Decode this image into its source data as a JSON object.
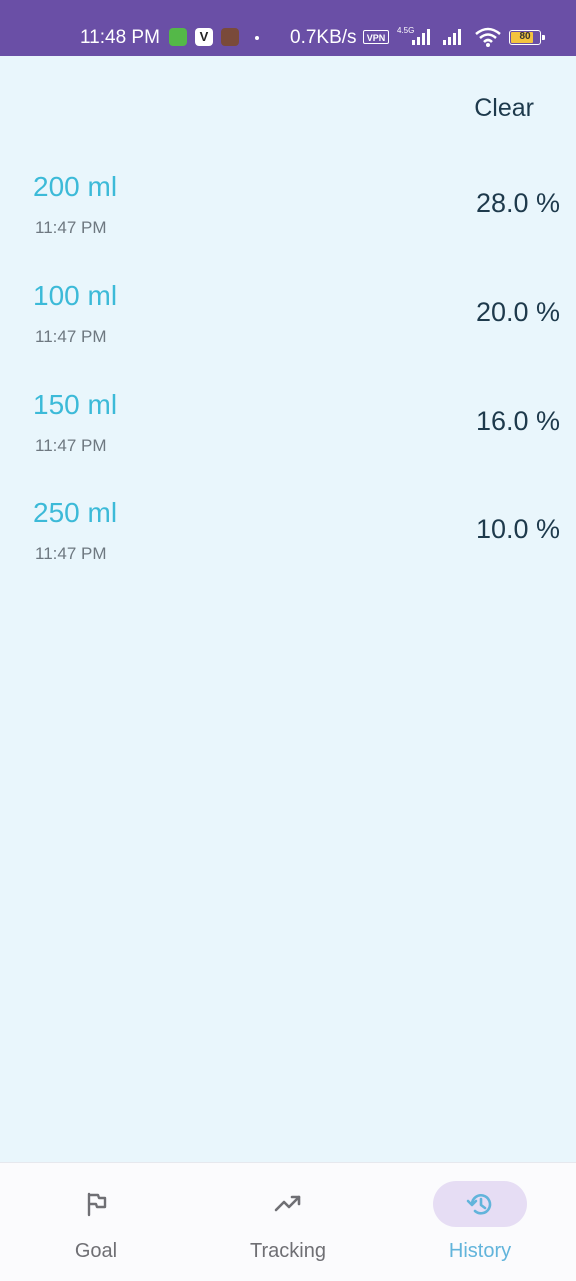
{
  "status_bar": {
    "time": "11:48 PM",
    "net_speed": "0.7KB/s",
    "vpn_label": "VPN",
    "network_type": "4.5G",
    "battery_level": "80",
    "battery_fraction": 0.8,
    "icons": [
      "notification-app-icon",
      "v-app-icon",
      "game-app-icon",
      "dot-icon",
      "signal-icon",
      "signal-icon",
      "wifi-icon",
      "battery-icon"
    ]
  },
  "header": {
    "clear_label": "Clear"
  },
  "history": {
    "entries": [
      {
        "amount": "200 ml",
        "time": "11:47 PM",
        "percent": "28.0 %"
      },
      {
        "amount": "100 ml",
        "time": "11:47 PM",
        "percent": "20.0 %"
      },
      {
        "amount": "150 ml",
        "time": "11:47 PM",
        "percent": "16.0 %"
      },
      {
        "amount": "250 ml",
        "time": "11:47 PM",
        "percent": "10.0 %"
      }
    ]
  },
  "bottom_nav": {
    "items": [
      {
        "label": "Goal",
        "icon": "flag-icon",
        "active": false
      },
      {
        "label": "Tracking",
        "icon": "trending-up-icon",
        "active": false
      },
      {
        "label": "History",
        "icon": "history-icon",
        "active": true
      }
    ]
  },
  "colors": {
    "status_bar": "#6a4fa6",
    "background": "#e9f6fc",
    "amount_text": "#3cbad8",
    "percent_text": "#1e3a4c",
    "active_tab": "#62b4db",
    "active_pill": "#e6ddf4"
  }
}
